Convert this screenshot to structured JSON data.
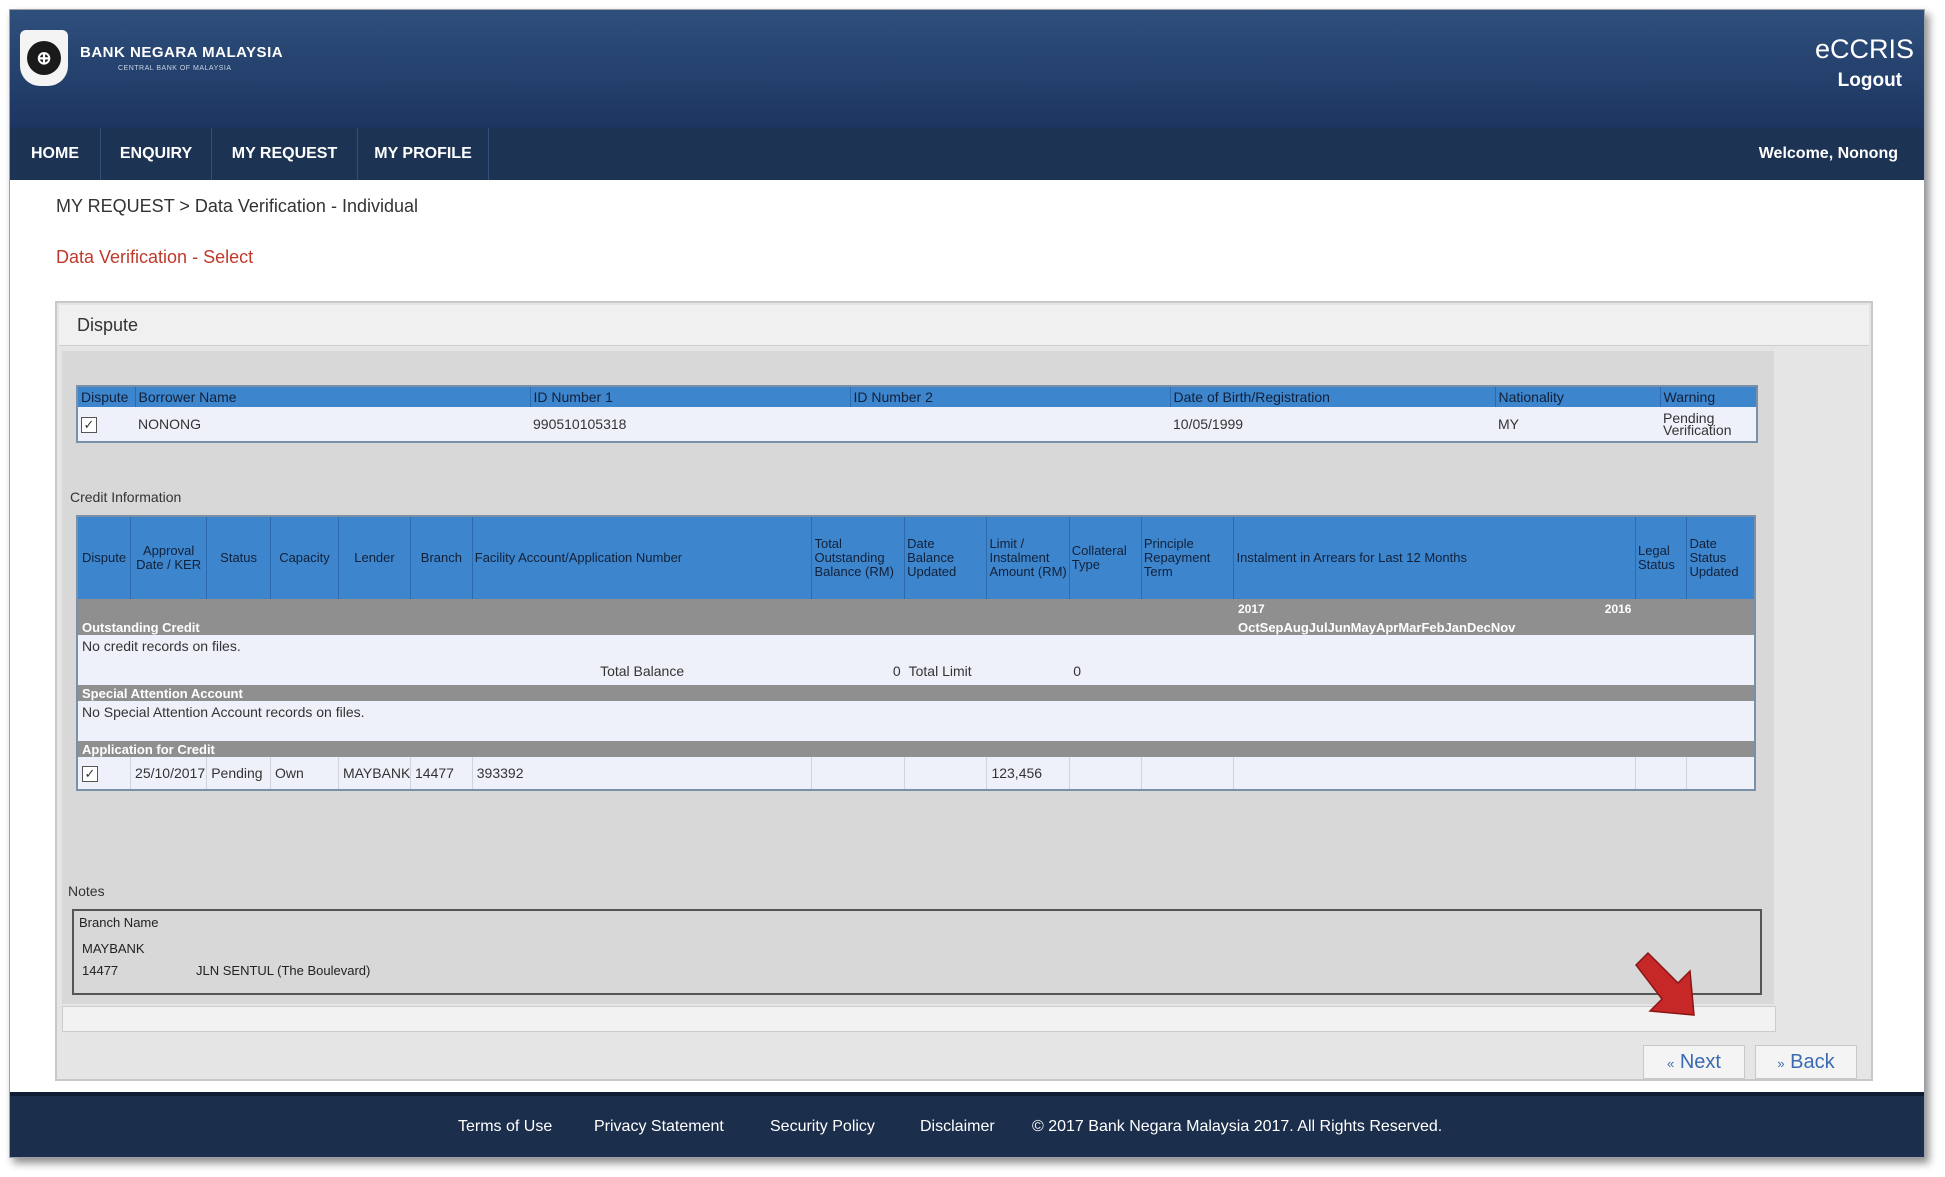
{
  "header": {
    "bank_name": "BANK NEGARA MALAYSIA",
    "bank_subtitle": "CENTRAL BANK OF MALAYSIA",
    "app_name": "eCCRIS",
    "logout": "Logout"
  },
  "nav": {
    "items": [
      "HOME",
      "ENQUIRY",
      "MY REQUEST",
      "MY PROFILE"
    ],
    "welcome": "Welcome, Nonong"
  },
  "breadcrumb": "MY REQUEST > Data Verification - Individual",
  "subtitle": "Data Verification - Select",
  "panel": {
    "title": "Dispute",
    "borrower_headers": [
      "Dispute",
      "Borrower Name",
      "ID Number 1",
      "ID Number 2",
      "Date of Birth/Registration",
      "Nationality",
      "Warning"
    ],
    "borrower_row": {
      "checked": "✓",
      "name": "NONONG",
      "id1": "990510105318",
      "id2": "",
      "dob": "10/05/1999",
      "nationality": "MY",
      "warning": "Pending Verification"
    },
    "credit_label": "Credit Information",
    "credit_headers": [
      "Dispute",
      "Approval Date / KER",
      "Status",
      "Capacity",
      "Lender",
      "Branch",
      "Facility Account/Application Number",
      "Total Outstanding Balance (RM)",
      "Date Balance Updated",
      "Limit / Instalment Amount (RM)",
      "Collateral Type",
      "Principle Repayment Term",
      "Instalment in Arrears for Last 12 Months",
      "Legal Status",
      "Date Status Updated"
    ],
    "years": [
      "2017",
      "2016"
    ],
    "months": "OctSepAugJulJunMayAprMarFebJanDecNov",
    "outstanding_label": "Outstanding Credit",
    "no_credit": "No credit records on files.",
    "total_balance_label": "Total Balance",
    "total_balance_value": "0",
    "total_limit_label": "Total Limit",
    "total_limit_value": "0",
    "saa_label": "Special Attention Account",
    "no_saa": "No Special Attention Account records on files.",
    "app_credit_label": "Application for Credit",
    "app_row": {
      "checked": "✓",
      "date": "25/10/2017",
      "status": "Pending",
      "capacity": "Own",
      "lender": "MAYBANK",
      "branch": "14477",
      "facility": "393392",
      "limit": "123,456"
    },
    "notes_label": "Notes",
    "notes": {
      "header": "Branch Name",
      "lender": "MAYBANK",
      "branch_code": "14477",
      "branch_name": "JLN SENTUL (The Boulevard)"
    }
  },
  "buttons": {
    "next": "Next",
    "back": "Back"
  },
  "footer": {
    "links": [
      "Terms of Use",
      "Privacy Statement",
      "Security Policy",
      "Disclaimer"
    ],
    "copyright": "© 2017 Bank Negara Malaysia 2017. All Rights Reserved."
  },
  "colors": {
    "header": "#1c3560",
    "nav": "#1d3354",
    "table_header": "#3d85cc",
    "subtitle": "#c0392b",
    "arrow": "#c62828"
  }
}
